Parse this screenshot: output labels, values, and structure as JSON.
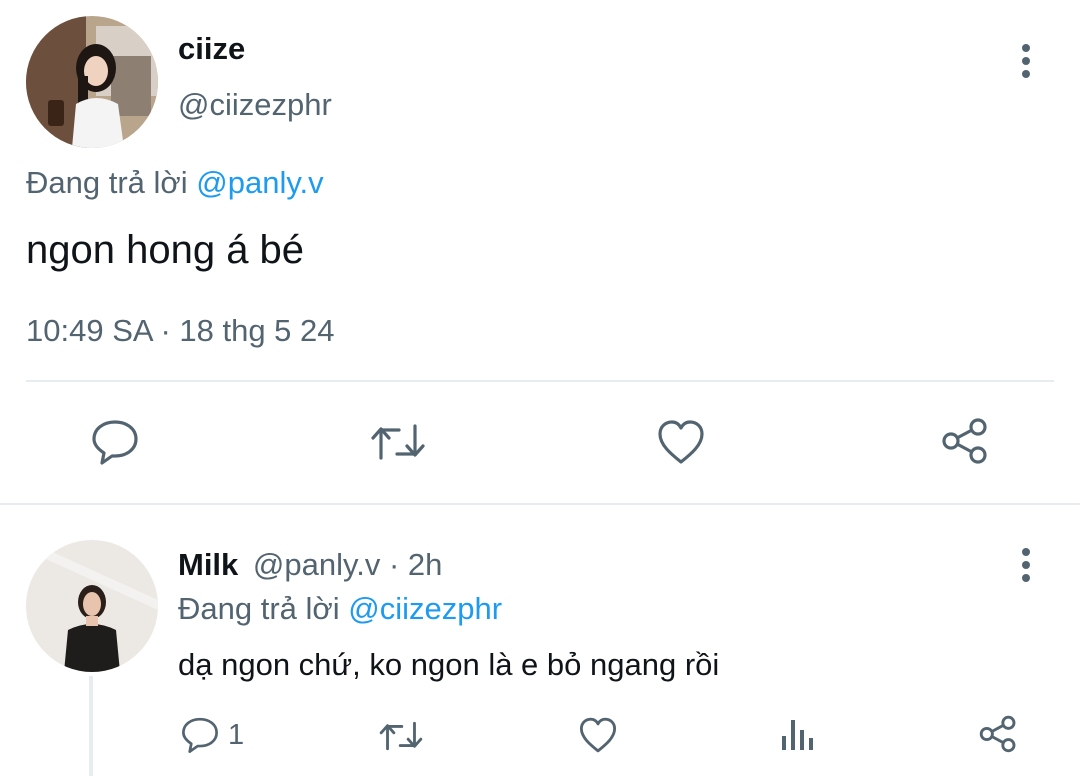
{
  "main_tweet": {
    "author_name": "ciize",
    "author_handle": "@ciizezphr",
    "replying_prefix": "Đang trả lời",
    "replying_to": "@panly.v",
    "text": "ngon hong á bé",
    "timestamp": "10:49 SA · 18 thg 5 24",
    "actions": [
      "reply-icon",
      "retweet-icon",
      "like-icon",
      "share-icon"
    ]
  },
  "reply": {
    "author_name": "Milk",
    "author_handle": "@panly.v",
    "time": "· 2h",
    "replying_prefix": "Đang trả lời",
    "replying_to": "@ciizezphr",
    "text": "dạ ngon chứ, ko ngon là e bỏ ngang rồi",
    "reply_count": "1",
    "actions": [
      "reply-icon",
      "retweet-icon",
      "like-icon",
      "analytics-icon",
      "share-icon"
    ]
  },
  "colors": {
    "accent": "#1d9bf0",
    "muted": "#536471",
    "divider": "#e6ecf0",
    "icon": "#536471"
  }
}
